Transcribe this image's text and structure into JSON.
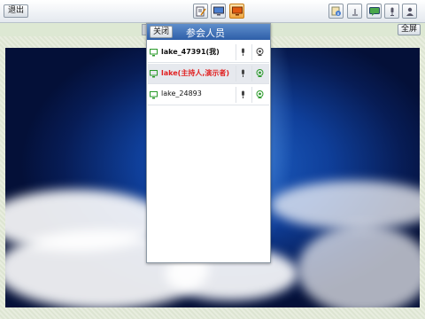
{
  "toolbar": {
    "exit_label": "退出",
    "center_icons": [
      "document-icon",
      "screen-share-icon",
      "presentation-icon"
    ],
    "right_icons": [
      "info-icon",
      "upload-icon",
      "chat-icon",
      "mic-user-icon",
      "user-icon"
    ]
  },
  "fullscreen_label": "全屏",
  "panel": {
    "title": "参会人员",
    "close_label": "关闭",
    "participants": [
      {
        "name": "lake_47391(我)"
      },
      {
        "name": "lake(主持人,演示者)"
      },
      {
        "name": "lake_24893"
      }
    ]
  },
  "colors": {
    "host_text": "#e12121",
    "panel_header": "#2d5ea8",
    "device_green": "#2a9a2a"
  }
}
